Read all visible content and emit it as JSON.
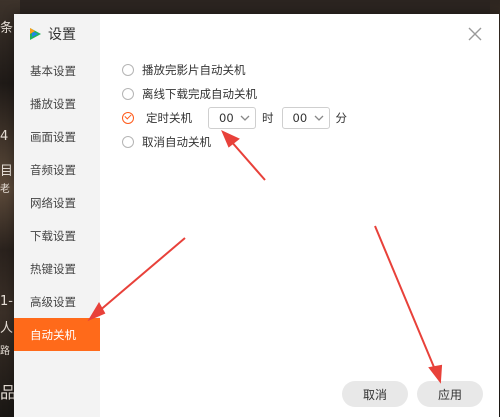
{
  "window": {
    "title": "设置"
  },
  "sidebar": {
    "items": [
      {
        "label": "基本设置"
      },
      {
        "label": "播放设置"
      },
      {
        "label": "画面设置"
      },
      {
        "label": "音频设置"
      },
      {
        "label": "网络设置"
      },
      {
        "label": "下载设置"
      },
      {
        "label": "热键设置"
      },
      {
        "label": "高级设置"
      },
      {
        "label": "自动关机",
        "active": true
      }
    ]
  },
  "options": [
    {
      "label": "播放完影片自动关机",
      "checked": false
    },
    {
      "label": "离线下载完成自动关机",
      "checked": false
    },
    {
      "label": "定时关机",
      "checked": true
    },
    {
      "label": "取消自动关机",
      "checked": false
    }
  ],
  "timer": {
    "hour": "00",
    "hour_unit": "时",
    "minute": "00",
    "minute_unit": "分"
  },
  "buttons": {
    "cancel": "取消",
    "apply": "应用"
  },
  "background": {
    "left_text": [
      "条",
      "4",
      "目",
      "老",
      "1-",
      "人",
      "路",
      "品"
    ]
  },
  "colors": {
    "accent": "#ff6a1a",
    "sidebar_bg": "#f3f3f3",
    "annotation_arrow": "#e8413a"
  },
  "icons": {
    "logo": "play-logo-icon",
    "close": "close-icon",
    "dropdown": "chevron-down-icon"
  }
}
